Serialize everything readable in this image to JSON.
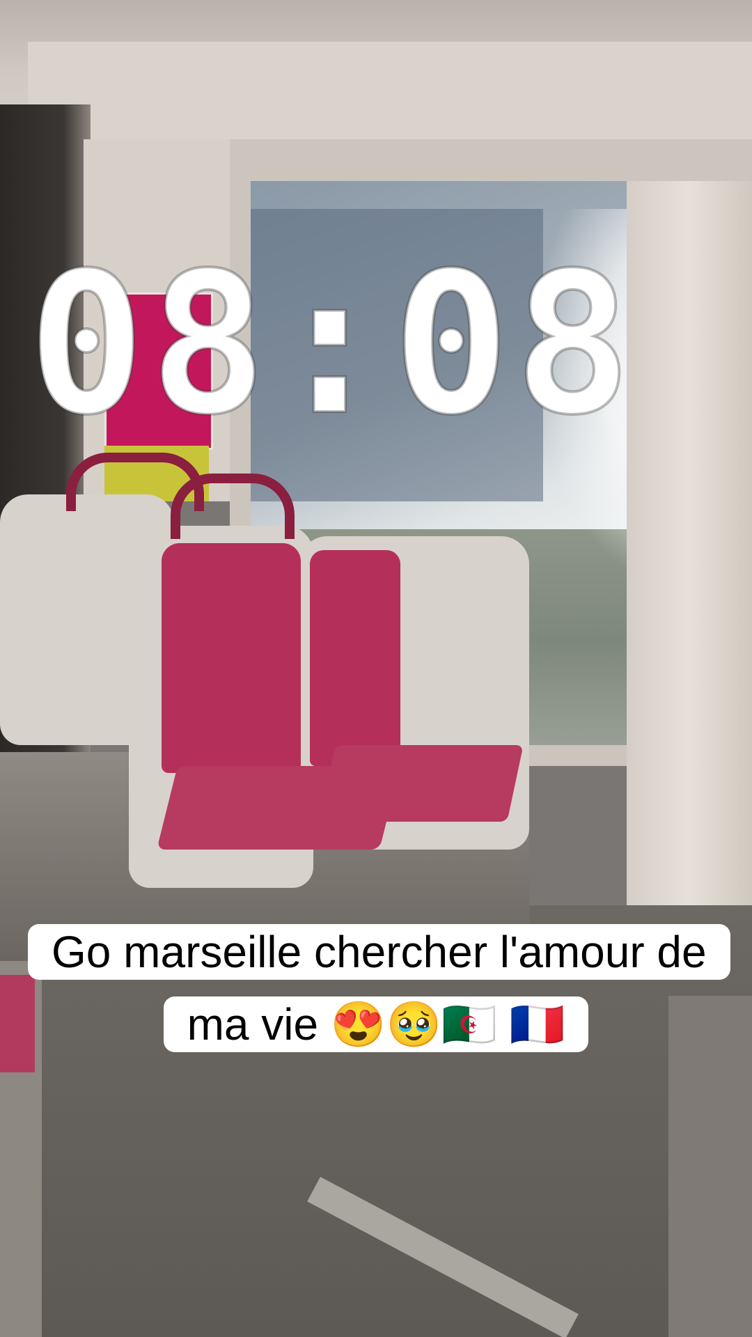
{
  "overlay": {
    "clock_text": "08:08"
  },
  "caption": {
    "text": "Go marseille chercher l'amour de ma vie 😍🥹🇩🇿 🇫🇷"
  }
}
